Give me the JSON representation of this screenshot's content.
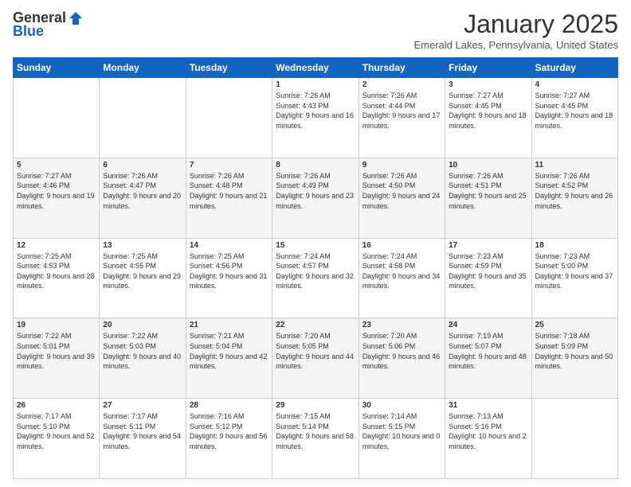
{
  "header": {
    "logo_general": "General",
    "logo_blue": "Blue",
    "month_title": "January 2025",
    "location": "Emerald Lakes, Pennsylvania, United States"
  },
  "weekdays": [
    "Sunday",
    "Monday",
    "Tuesday",
    "Wednesday",
    "Thursday",
    "Friday",
    "Saturday"
  ],
  "weeks": [
    [
      {
        "day": "",
        "sunrise": "",
        "sunset": "",
        "daylight": ""
      },
      {
        "day": "",
        "sunrise": "",
        "sunset": "",
        "daylight": ""
      },
      {
        "day": "",
        "sunrise": "",
        "sunset": "",
        "daylight": ""
      },
      {
        "day": "1",
        "sunrise": "Sunrise: 7:26 AM",
        "sunset": "Sunset: 4:43 PM",
        "daylight": "Daylight: 9 hours and 16 minutes."
      },
      {
        "day": "2",
        "sunrise": "Sunrise: 7:26 AM",
        "sunset": "Sunset: 4:44 PM",
        "daylight": "Daylight: 9 hours and 17 minutes."
      },
      {
        "day": "3",
        "sunrise": "Sunrise: 7:27 AM",
        "sunset": "Sunset: 4:45 PM",
        "daylight": "Daylight: 9 hours and 18 minutes."
      },
      {
        "day": "4",
        "sunrise": "Sunrise: 7:27 AM",
        "sunset": "Sunset: 4:45 PM",
        "daylight": "Daylight: 9 hours and 18 minutes."
      }
    ],
    [
      {
        "day": "5",
        "sunrise": "Sunrise: 7:27 AM",
        "sunset": "Sunset: 4:46 PM",
        "daylight": "Daylight: 9 hours and 19 minutes."
      },
      {
        "day": "6",
        "sunrise": "Sunrise: 7:26 AM",
        "sunset": "Sunset: 4:47 PM",
        "daylight": "Daylight: 9 hours and 20 minutes."
      },
      {
        "day": "7",
        "sunrise": "Sunrise: 7:26 AM",
        "sunset": "Sunset: 4:48 PM",
        "daylight": "Daylight: 9 hours and 21 minutes."
      },
      {
        "day": "8",
        "sunrise": "Sunrise: 7:26 AM",
        "sunset": "Sunset: 4:49 PM",
        "daylight": "Daylight: 9 hours and 23 minutes."
      },
      {
        "day": "9",
        "sunrise": "Sunrise: 7:26 AM",
        "sunset": "Sunset: 4:50 PM",
        "daylight": "Daylight: 9 hours and 24 minutes."
      },
      {
        "day": "10",
        "sunrise": "Sunrise: 7:26 AM",
        "sunset": "Sunset: 4:51 PM",
        "daylight": "Daylight: 9 hours and 25 minutes."
      },
      {
        "day": "11",
        "sunrise": "Sunrise: 7:26 AM",
        "sunset": "Sunset: 4:52 PM",
        "daylight": "Daylight: 9 hours and 26 minutes."
      }
    ],
    [
      {
        "day": "12",
        "sunrise": "Sunrise: 7:25 AM",
        "sunset": "Sunset: 4:53 PM",
        "daylight": "Daylight: 9 hours and 28 minutes."
      },
      {
        "day": "13",
        "sunrise": "Sunrise: 7:25 AM",
        "sunset": "Sunset: 4:55 PM",
        "daylight": "Daylight: 9 hours and 29 minutes."
      },
      {
        "day": "14",
        "sunrise": "Sunrise: 7:25 AM",
        "sunset": "Sunset: 4:56 PM",
        "daylight": "Daylight: 9 hours and 31 minutes."
      },
      {
        "day": "15",
        "sunrise": "Sunrise: 7:24 AM",
        "sunset": "Sunset: 4:57 PM",
        "daylight": "Daylight: 9 hours and 32 minutes."
      },
      {
        "day": "16",
        "sunrise": "Sunrise: 7:24 AM",
        "sunset": "Sunset: 4:58 PM",
        "daylight": "Daylight: 9 hours and 34 minutes."
      },
      {
        "day": "17",
        "sunrise": "Sunrise: 7:23 AM",
        "sunset": "Sunset: 4:59 PM",
        "daylight": "Daylight: 9 hours and 35 minutes."
      },
      {
        "day": "18",
        "sunrise": "Sunrise: 7:23 AM",
        "sunset": "Sunset: 5:00 PM",
        "daylight": "Daylight: 9 hours and 37 minutes."
      }
    ],
    [
      {
        "day": "19",
        "sunrise": "Sunrise: 7:22 AM",
        "sunset": "Sunset: 5:01 PM",
        "daylight": "Daylight: 9 hours and 39 minutes."
      },
      {
        "day": "20",
        "sunrise": "Sunrise: 7:22 AM",
        "sunset": "Sunset: 5:03 PM",
        "daylight": "Daylight: 9 hours and 40 minutes."
      },
      {
        "day": "21",
        "sunrise": "Sunrise: 7:21 AM",
        "sunset": "Sunset: 5:04 PM",
        "daylight": "Daylight: 9 hours and 42 minutes."
      },
      {
        "day": "22",
        "sunrise": "Sunrise: 7:20 AM",
        "sunset": "Sunset: 5:05 PM",
        "daylight": "Daylight: 9 hours and 44 minutes."
      },
      {
        "day": "23",
        "sunrise": "Sunrise: 7:20 AM",
        "sunset": "Sunset: 5:06 PM",
        "daylight": "Daylight: 9 hours and 46 minutes."
      },
      {
        "day": "24",
        "sunrise": "Sunrise: 7:19 AM",
        "sunset": "Sunset: 5:07 PM",
        "daylight": "Daylight: 9 hours and 48 minutes."
      },
      {
        "day": "25",
        "sunrise": "Sunrise: 7:18 AM",
        "sunset": "Sunset: 5:09 PM",
        "daylight": "Daylight: 9 hours and 50 minutes."
      }
    ],
    [
      {
        "day": "26",
        "sunrise": "Sunrise: 7:17 AM",
        "sunset": "Sunset: 5:10 PM",
        "daylight": "Daylight: 9 hours and 52 minutes."
      },
      {
        "day": "27",
        "sunrise": "Sunrise: 7:17 AM",
        "sunset": "Sunset: 5:11 PM",
        "daylight": "Daylight: 9 hours and 54 minutes."
      },
      {
        "day": "28",
        "sunrise": "Sunrise: 7:16 AM",
        "sunset": "Sunset: 5:12 PM",
        "daylight": "Daylight: 9 hours and 56 minutes."
      },
      {
        "day": "29",
        "sunrise": "Sunrise: 7:15 AM",
        "sunset": "Sunset: 5:14 PM",
        "daylight": "Daylight: 9 hours and 58 minutes."
      },
      {
        "day": "30",
        "sunrise": "Sunrise: 7:14 AM",
        "sunset": "Sunset: 5:15 PM",
        "daylight": "Daylight: 10 hours and 0 minutes."
      },
      {
        "day": "31",
        "sunrise": "Sunrise: 7:13 AM",
        "sunset": "Sunset: 5:16 PM",
        "daylight": "Daylight: 10 hours and 2 minutes."
      },
      {
        "day": "",
        "sunrise": "",
        "sunset": "",
        "daylight": ""
      }
    ]
  ]
}
